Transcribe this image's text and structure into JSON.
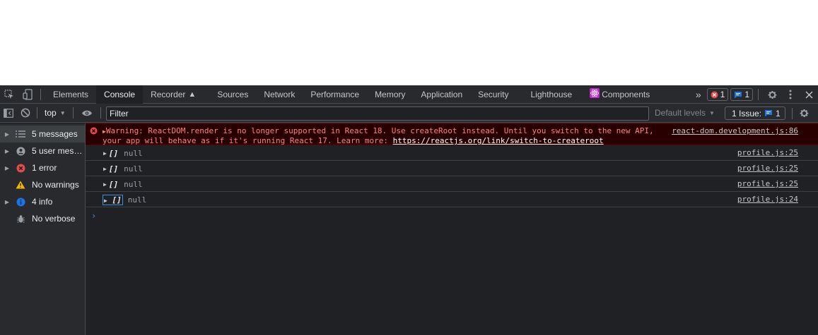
{
  "tabs": [
    {
      "label": "Elements",
      "active": false
    },
    {
      "label": "Console",
      "active": true
    },
    {
      "label": "Recorder",
      "active": false
    },
    {
      "label": "Sources",
      "active": false
    },
    {
      "label": "Network",
      "active": false
    },
    {
      "label": "Performance",
      "active": false
    },
    {
      "label": "Memory",
      "active": false
    },
    {
      "label": "Application",
      "active": false
    },
    {
      "label": "Security",
      "active": false
    },
    {
      "label": "Lighthouse",
      "active": false
    },
    {
      "label": "Components",
      "active": false
    }
  ],
  "counters": {
    "errors": "1",
    "messages": "1"
  },
  "toolbar": {
    "context": "top",
    "filter_placeholder": "Filter",
    "levels": "Default levels",
    "issues_label": "1 Issue:",
    "issues_count": "1"
  },
  "sidebar": {
    "items": [
      {
        "label": "5 messages",
        "icon": "list-icon"
      },
      {
        "label": "5 user mes…",
        "icon": "user-icon"
      },
      {
        "label": "1 error",
        "icon": "error-icon"
      },
      {
        "label": "No warnings",
        "icon": "warning-icon"
      },
      {
        "label": "4 info",
        "icon": "info-icon"
      },
      {
        "label": "No verbose",
        "icon": "bug-icon"
      }
    ]
  },
  "console": {
    "error": {
      "line1": "Warning: ReactDOM.render is no longer supported in React 18. Use createRoot instead. Until you switch to the new API,",
      "line2_prefix": "your app will behave as if it's running React 17. Learn more: ",
      "link": "https://reactjs.org/link/switch-to-createroot",
      "source": "react-dom.development.js:86"
    },
    "logs": [
      {
        "array": "[]",
        "value": "null",
        "source": "profile.js:25"
      },
      {
        "array": "[]",
        "value": "null",
        "source": "profile.js:25"
      },
      {
        "array": "[]",
        "value": "null",
        "source": "profile.js:25"
      },
      {
        "array": "[]",
        "value": "null",
        "source": "profile.js:24"
      }
    ],
    "prompt": "›"
  },
  "colors": {
    "error": "#e34b4b",
    "info": "#1a73e8",
    "warning": "#f2b600",
    "accent": "#3c8fdc"
  }
}
